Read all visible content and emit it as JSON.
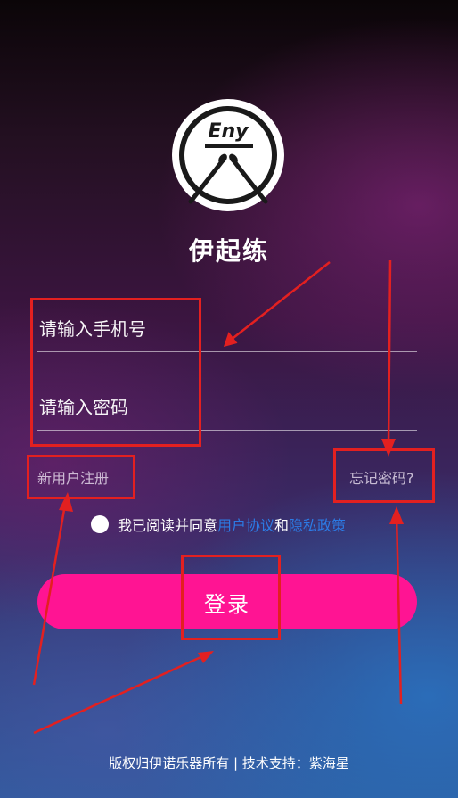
{
  "app": {
    "logo_text": "Eny",
    "title": "伊起练"
  },
  "login_form": {
    "phone_placeholder": "请输入手机号",
    "password_placeholder": "请输入密码",
    "register_link": "新用户注册",
    "forgot_link": "忘记密码?",
    "agree_prefix": "我已阅读并同意",
    "user_agreement": "用户协议",
    "and_text": "和",
    "privacy_policy": "隐私政策",
    "login_button": "登录"
  },
  "footer": {
    "copyright": "版权归伊诺乐器所有 | 技术支持：紫海星"
  },
  "colors": {
    "accent": "#ff1493",
    "link": "#2c7be5",
    "annotation": "#e32020"
  }
}
